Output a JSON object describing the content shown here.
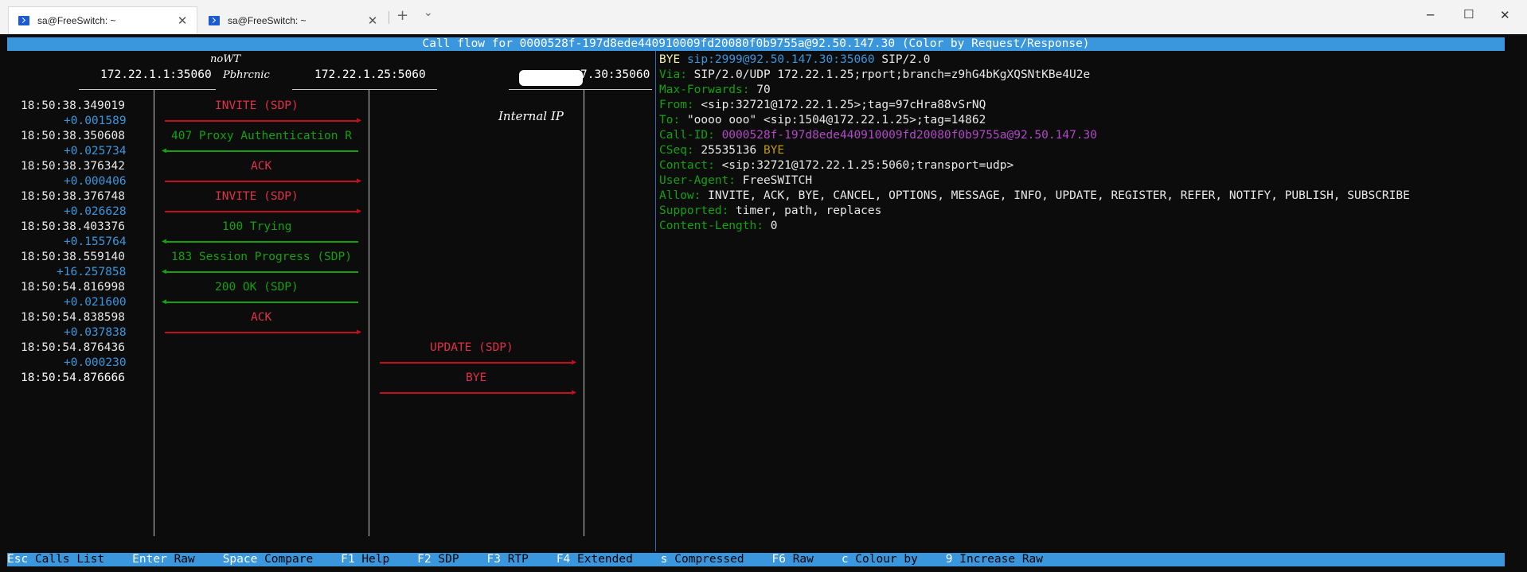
{
  "window": {
    "tabs": [
      {
        "label": "sa@FreeSwitch: ~",
        "active": true
      },
      {
        "label": "sa@FreeSwitch: ~",
        "active": false
      }
    ],
    "new_tab_glyph": "+",
    "dropdown_glyph": "⌄",
    "minimize_glyph": "─",
    "maximize_glyph": "☐",
    "close_glyph": "✕",
    "tab_close_glyph": "✕"
  },
  "header": {
    "title": "Call flow for 0000528f-197d8ede440910009fd20080f0b9755a@92.50.147.30 (Color by Request/Response)"
  },
  "flow": {
    "hosts": [
      "172.22.1.1:35060",
      "172.22.1.25:5060",
      "7.30:35060"
    ],
    "rows": [
      {
        "time": "18:50:38.349019",
        "delta": "+0.001589",
        "label": "INVITE (SDP)",
        "color": "red",
        "from": 0,
        "to": 1
      },
      {
        "time": "18:50:38.350608",
        "delta": "+0.025734",
        "label": "407 Proxy Authentication R",
        "color": "green",
        "from": 1,
        "to": 0
      },
      {
        "time": "18:50:38.376342",
        "delta": "+0.000406",
        "label": "ACK",
        "color": "red",
        "from": 0,
        "to": 1
      },
      {
        "time": "18:50:38.376748",
        "delta": "+0.026628",
        "label": "INVITE (SDP)",
        "color": "red",
        "from": 0,
        "to": 1
      },
      {
        "time": "18:50:38.403376",
        "delta": "+0.155764",
        "label": "100 Trying",
        "color": "green",
        "from": 1,
        "to": 0
      },
      {
        "time": "18:50:38.559140",
        "delta": "+16.257858",
        "label": "183 Session Progress (SDP)",
        "color": "green",
        "from": 1,
        "to": 0
      },
      {
        "time": "18:50:54.816998",
        "delta": "+0.021600",
        "label": "200 OK (SDP)",
        "color": "green",
        "from": 1,
        "to": 0
      },
      {
        "time": "18:50:54.838598",
        "delta": "+0.037838",
        "label": "ACK",
        "color": "red",
        "from": 0,
        "to": 1
      },
      {
        "time": "18:50:54.876436",
        "delta": "+0.000230",
        "label": "UPDATE (SDP)",
        "color": "red",
        "from": 1,
        "to": 2
      },
      {
        "time": "18:50:54.876666",
        "delta": "",
        "label": "BYE",
        "color": "red",
        "from": 1,
        "to": 2
      }
    ]
  },
  "detail": {
    "request_line": {
      "method": "BYE",
      "uri": "sip:2999@92.50.147.30:35060",
      "version": "SIP/2.0"
    },
    "headers": [
      {
        "name": "Via:",
        "value": "SIP/2.0/UDP 172.22.1.25;rport;branch=z9hG4bKgXQSNtKBe4U2e"
      },
      {
        "name": "Max-Forwards:",
        "value": "70"
      },
      {
        "name": "From:",
        "value": "<sip:32721@172.22.1.25>;tag=97cHra88vSrNQ"
      },
      {
        "name": "To:",
        "value": "\"oooo ooo\" <sip:1504@172.22.1.25>;tag=14862"
      },
      {
        "name": "Call-ID:",
        "value": "0000528f-197d8ede440910009fd20080f0b9755a@92.50.147.30"
      },
      {
        "name": "CSeq:",
        "value": "25535136",
        "value2": "BYE"
      },
      {
        "name": "Contact:",
        "value": "<sip:32721@172.22.1.25:5060;transport=udp>"
      },
      {
        "name": "User-Agent:",
        "value": "FreeSWITCH"
      },
      {
        "name": "Allow:",
        "value": "INVITE, ACK, BYE, CANCEL, OPTIONS, MESSAGE, INFO, UPDATE, REGISTER, REFER, NOTIFY, PUBLISH, SUBSCRIBE"
      },
      {
        "name": "Supported:",
        "value": "timer, path, replaces"
      },
      {
        "name": "Content-Length:",
        "value": "0"
      }
    ]
  },
  "footer": {
    "items": [
      {
        "key": "Esc",
        "action": "Calls List"
      },
      {
        "key": "Enter",
        "action": "Raw"
      },
      {
        "key": "Space",
        "action": "Compare"
      },
      {
        "key": "F1",
        "action": "Help"
      },
      {
        "key": "F2",
        "action": "SDP"
      },
      {
        "key": "F3",
        "action": "RTP"
      },
      {
        "key": "F4",
        "action": "Extended"
      },
      {
        "key": "s",
        "action": "Compressed"
      },
      {
        "key": "F6",
        "action": "Raw"
      },
      {
        "key": "c",
        "action": "Colour by"
      },
      {
        "key": "9",
        "action": "Increase Raw"
      }
    ]
  },
  "annotations": {
    "note1": "noWT",
    "note2": "Pbhrcnic",
    "note3": "Internal IP"
  },
  "colors": {
    "bar_blue": "#3a96dd",
    "request_red": "#c50f1f",
    "response_green": "#13a10e"
  }
}
